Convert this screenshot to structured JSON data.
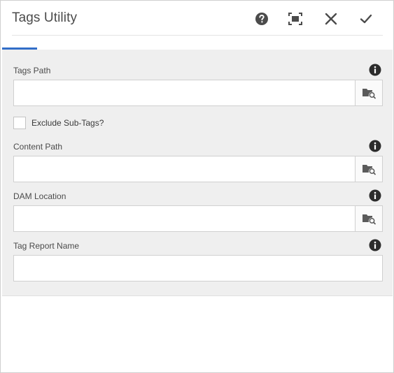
{
  "dialog": {
    "title": "Tags Utility",
    "actions": [
      {
        "name": "help",
        "icon": "help-icon"
      },
      {
        "name": "fullscreen",
        "icon": "fullscreen-icon"
      },
      {
        "name": "close",
        "icon": "close-icon"
      },
      {
        "name": "done",
        "icon": "checkmark-icon"
      }
    ]
  },
  "form": {
    "tags_path": {
      "label": "Tags Path",
      "value": ""
    },
    "exclude_subtags": {
      "label": "Exclude Sub-Tags?",
      "checked": false
    },
    "content_path": {
      "label": "Content Path",
      "value": ""
    },
    "dam_location": {
      "label": "DAM Location",
      "value": ""
    },
    "report_name": {
      "label": "Tag Report Name",
      "value": ""
    }
  },
  "colors": {
    "accent": "#326ec8",
    "panel_bg": "#efefef",
    "icon": "#4b4b4b"
  }
}
